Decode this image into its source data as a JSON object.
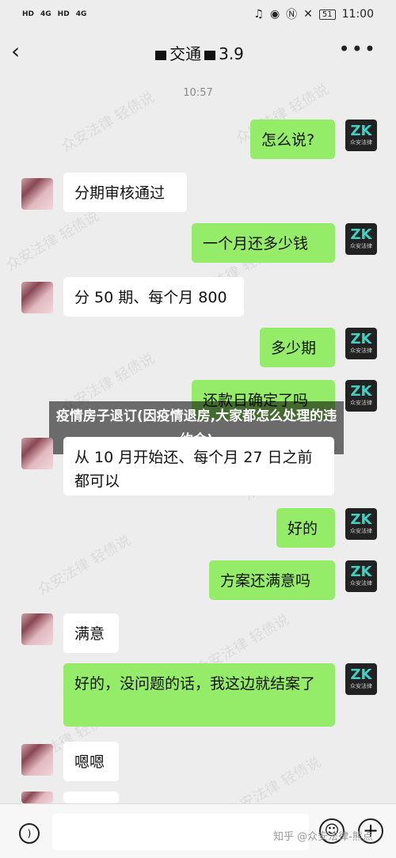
{
  "status_bar": {
    "left": [
      "HD",
      "4G",
      "HD",
      "4G"
    ],
    "battery": "51",
    "clock": "11:00"
  },
  "header": {
    "title_part1": "交通",
    "title_part2": "3.9"
  },
  "timestamp": "10:57",
  "watermark": "众安法律 轻债说",
  "messages": [
    {
      "from": "me",
      "text": "怎么说?"
    },
    {
      "from": "other",
      "text": "分期审核通过"
    },
    {
      "from": "me",
      "text": "一个月还多少钱"
    },
    {
      "from": "other",
      "text": "分 50 期、每个月 800"
    },
    {
      "from": "me",
      "text": "多少期"
    },
    {
      "from": "me",
      "text": "还款日确定了吗"
    },
    {
      "from": "other",
      "text": "从 10 月开始还、每个月 27 日之前都可以"
    },
    {
      "from": "me",
      "text": "好的"
    },
    {
      "from": "me",
      "text": "方案还满意吗"
    },
    {
      "from": "other",
      "text": "满意"
    },
    {
      "from": "me",
      "text": "好的，没问题的话，我这边就结案了"
    },
    {
      "from": "other",
      "text": "嗯嗯"
    }
  ],
  "overlay_title": "疫情房子退订(因疫情退房,大家都怎么处理的违约金)",
  "avatar_logo": "ZK",
  "avatar_sub": "众安法律",
  "credit": "知乎 @众安法律-熊点"
}
